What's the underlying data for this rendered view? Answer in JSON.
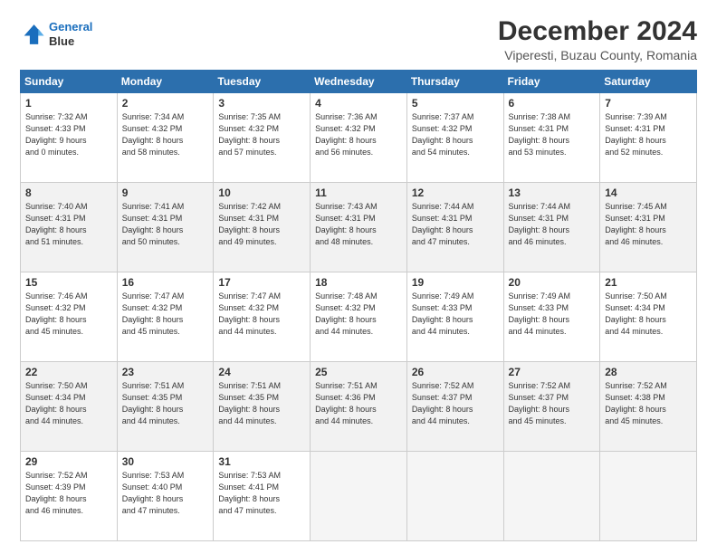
{
  "header": {
    "logo_line1": "General",
    "logo_line2": "Blue",
    "month": "December 2024",
    "location": "Viperesti, Buzau County, Romania"
  },
  "weekdays": [
    "Sunday",
    "Monday",
    "Tuesday",
    "Wednesday",
    "Thursday",
    "Friday",
    "Saturday"
  ],
  "weeks": [
    [
      {
        "day": "1",
        "info": "Sunrise: 7:32 AM\nSunset: 4:33 PM\nDaylight: 9 hours\nand 0 minutes."
      },
      {
        "day": "2",
        "info": "Sunrise: 7:34 AM\nSunset: 4:32 PM\nDaylight: 8 hours\nand 58 minutes."
      },
      {
        "day": "3",
        "info": "Sunrise: 7:35 AM\nSunset: 4:32 PM\nDaylight: 8 hours\nand 57 minutes."
      },
      {
        "day": "4",
        "info": "Sunrise: 7:36 AM\nSunset: 4:32 PM\nDaylight: 8 hours\nand 56 minutes."
      },
      {
        "day": "5",
        "info": "Sunrise: 7:37 AM\nSunset: 4:32 PM\nDaylight: 8 hours\nand 54 minutes."
      },
      {
        "day": "6",
        "info": "Sunrise: 7:38 AM\nSunset: 4:31 PM\nDaylight: 8 hours\nand 53 minutes."
      },
      {
        "day": "7",
        "info": "Sunrise: 7:39 AM\nSunset: 4:31 PM\nDaylight: 8 hours\nand 52 minutes."
      }
    ],
    [
      {
        "day": "8",
        "info": "Sunrise: 7:40 AM\nSunset: 4:31 PM\nDaylight: 8 hours\nand 51 minutes."
      },
      {
        "day": "9",
        "info": "Sunrise: 7:41 AM\nSunset: 4:31 PM\nDaylight: 8 hours\nand 50 minutes."
      },
      {
        "day": "10",
        "info": "Sunrise: 7:42 AM\nSunset: 4:31 PM\nDaylight: 8 hours\nand 49 minutes."
      },
      {
        "day": "11",
        "info": "Sunrise: 7:43 AM\nSunset: 4:31 PM\nDaylight: 8 hours\nand 48 minutes."
      },
      {
        "day": "12",
        "info": "Sunrise: 7:44 AM\nSunset: 4:31 PM\nDaylight: 8 hours\nand 47 minutes."
      },
      {
        "day": "13",
        "info": "Sunrise: 7:44 AM\nSunset: 4:31 PM\nDaylight: 8 hours\nand 46 minutes."
      },
      {
        "day": "14",
        "info": "Sunrise: 7:45 AM\nSunset: 4:31 PM\nDaylight: 8 hours\nand 46 minutes."
      }
    ],
    [
      {
        "day": "15",
        "info": "Sunrise: 7:46 AM\nSunset: 4:32 PM\nDaylight: 8 hours\nand 45 minutes."
      },
      {
        "day": "16",
        "info": "Sunrise: 7:47 AM\nSunset: 4:32 PM\nDaylight: 8 hours\nand 45 minutes."
      },
      {
        "day": "17",
        "info": "Sunrise: 7:47 AM\nSunset: 4:32 PM\nDaylight: 8 hours\nand 44 minutes."
      },
      {
        "day": "18",
        "info": "Sunrise: 7:48 AM\nSunset: 4:32 PM\nDaylight: 8 hours\nand 44 minutes."
      },
      {
        "day": "19",
        "info": "Sunrise: 7:49 AM\nSunset: 4:33 PM\nDaylight: 8 hours\nand 44 minutes."
      },
      {
        "day": "20",
        "info": "Sunrise: 7:49 AM\nSunset: 4:33 PM\nDaylight: 8 hours\nand 44 minutes."
      },
      {
        "day": "21",
        "info": "Sunrise: 7:50 AM\nSunset: 4:34 PM\nDaylight: 8 hours\nand 44 minutes."
      }
    ],
    [
      {
        "day": "22",
        "info": "Sunrise: 7:50 AM\nSunset: 4:34 PM\nDaylight: 8 hours\nand 44 minutes."
      },
      {
        "day": "23",
        "info": "Sunrise: 7:51 AM\nSunset: 4:35 PM\nDaylight: 8 hours\nand 44 minutes."
      },
      {
        "day": "24",
        "info": "Sunrise: 7:51 AM\nSunset: 4:35 PM\nDaylight: 8 hours\nand 44 minutes."
      },
      {
        "day": "25",
        "info": "Sunrise: 7:51 AM\nSunset: 4:36 PM\nDaylight: 8 hours\nand 44 minutes."
      },
      {
        "day": "26",
        "info": "Sunrise: 7:52 AM\nSunset: 4:37 PM\nDaylight: 8 hours\nand 44 minutes."
      },
      {
        "day": "27",
        "info": "Sunrise: 7:52 AM\nSunset: 4:37 PM\nDaylight: 8 hours\nand 45 minutes."
      },
      {
        "day": "28",
        "info": "Sunrise: 7:52 AM\nSunset: 4:38 PM\nDaylight: 8 hours\nand 45 minutes."
      }
    ],
    [
      {
        "day": "29",
        "info": "Sunrise: 7:52 AM\nSunset: 4:39 PM\nDaylight: 8 hours\nand 46 minutes."
      },
      {
        "day": "30",
        "info": "Sunrise: 7:53 AM\nSunset: 4:40 PM\nDaylight: 8 hours\nand 47 minutes."
      },
      {
        "day": "31",
        "info": "Sunrise: 7:53 AM\nSunset: 4:41 PM\nDaylight: 8 hours\nand 47 minutes."
      },
      null,
      null,
      null,
      null
    ]
  ]
}
